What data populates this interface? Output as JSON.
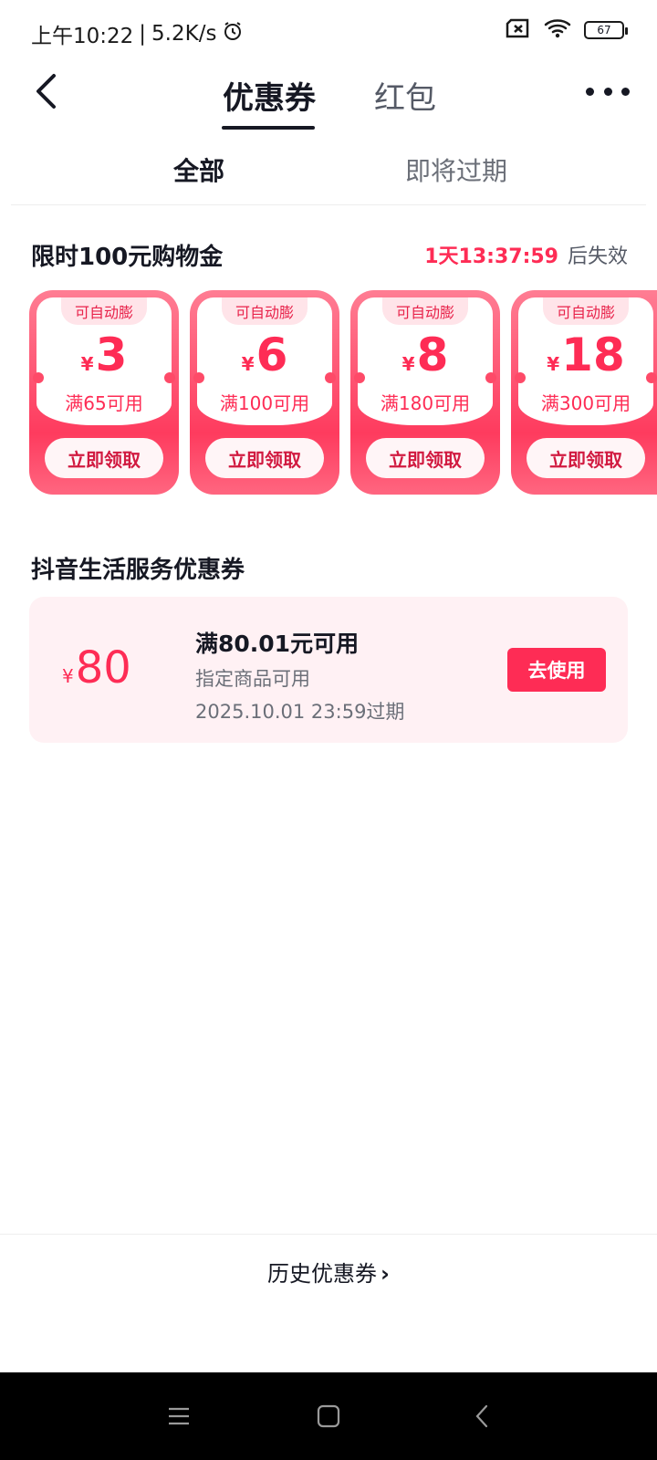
{
  "status_bar": {
    "time": "上午10:22",
    "separator": "|",
    "speed": "5.2K/s",
    "battery": "67"
  },
  "header": {
    "tabs": [
      {
        "label": "优惠券",
        "active": true
      },
      {
        "label": "红包",
        "active": false
      }
    ]
  },
  "sub_tabs": [
    {
      "label": "全部",
      "active": true
    },
    {
      "label": "即将过期",
      "active": false
    }
  ],
  "limited_section": {
    "title": "限时100元购物金",
    "countdown": "1天13:37:59",
    "countdown_suffix": "后失效",
    "coupons": [
      {
        "tag": "可自动膨",
        "currency": "¥",
        "amount": "3",
        "condition": "满65可用",
        "button": "立即领取"
      },
      {
        "tag": "可自动膨",
        "currency": "¥",
        "amount": "6",
        "condition": "满100可用",
        "button": "立即领取"
      },
      {
        "tag": "可自动膨",
        "currency": "¥",
        "amount": "8",
        "condition": "满180可用",
        "button": "立即领取"
      },
      {
        "tag": "可自动膨",
        "currency": "¥",
        "amount": "18",
        "condition": "满300可用",
        "button": "立即领取"
      }
    ]
  },
  "life_section": {
    "title": "抖音生活服务优惠券",
    "coupon": {
      "currency": "¥",
      "amount": "80",
      "title": "满80.01元可用",
      "subtitle": "指定商品可用",
      "expire": "2025.10.01 23:59过期",
      "button": "去使用"
    }
  },
  "history": {
    "label": "历史优惠券",
    "chevron": "›"
  },
  "colors": {
    "accent": "#fe2c55",
    "coupon_bg": "#fff1f4",
    "text_primary": "#161823",
    "text_secondary": "#6b6f78"
  }
}
